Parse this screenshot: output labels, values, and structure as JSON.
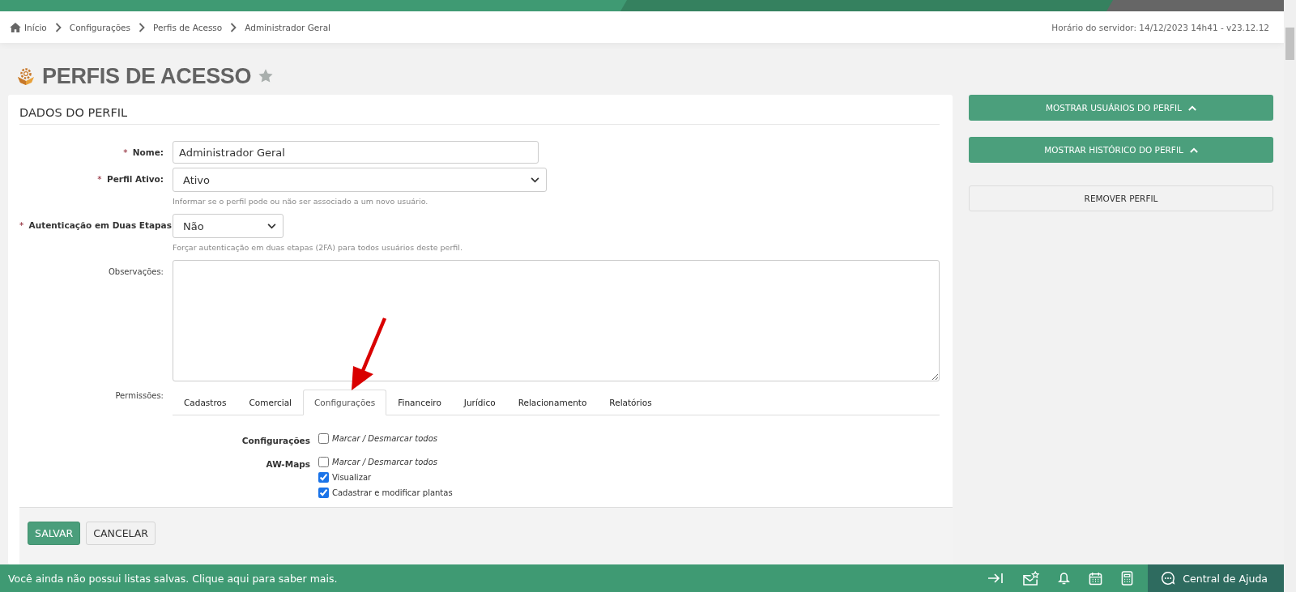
{
  "breadcrumb": {
    "items": [
      {
        "label": "Início"
      },
      {
        "label": "Configurações"
      },
      {
        "label": "Perfis de Acesso"
      },
      {
        "label": "Administrador Geral"
      }
    ],
    "server_time": "Horário do servidor: 14/12/2023 14h41 - v23.12.12"
  },
  "page": {
    "title": "PERFIS DE ACESSO",
    "favorite": false
  },
  "profile": {
    "heading": "DADOS DO PERFIL",
    "required_mark": "*",
    "fields": [
      {
        "kind": "text",
        "label": "Nome:",
        "required": true,
        "value": "Administrador Geral"
      },
      {
        "kind": "select",
        "label": "Perfil Ativo:",
        "required": true,
        "value": "Ativo",
        "hint": "Informar se o perfil pode ou não ser associado a um novo usuário."
      },
      {
        "kind": "short_select",
        "label": "Autenticação em Duas Etapas",
        "required": true,
        "value": "Não",
        "hint": "Forçar autenticação em duas etapas (2FA) para todos usuários deste perfil."
      },
      {
        "kind": "textarea",
        "label": "Observações:",
        "required": false
      }
    ]
  },
  "permissions": {
    "label": "Permissões:",
    "tabs": [
      {
        "label": "Cadastros",
        "selected": false
      },
      {
        "label": "Comercial",
        "selected": false
      },
      {
        "label": "Configurações",
        "selected": true
      },
      {
        "label": "Financeiro",
        "selected": false
      },
      {
        "label": "Jurídico",
        "selected": false
      },
      {
        "label": "Relacionamento",
        "selected": false
      },
      {
        "label": "Relatórios",
        "selected": false
      }
    ],
    "groups": [
      {
        "title": "Configurações",
        "toggle_label": "Marcar / Desmarcar todos",
        "toggle_checked": false
      },
      {
        "title": "AW-Maps",
        "toggle_label": "Marcar / Desmarcar todos",
        "toggle_checked": false,
        "items": [
          {
            "label": "Visualizar",
            "checked": true
          },
          {
            "label": "Cadastrar e modificar plantas",
            "checked": true
          }
        ]
      }
    ]
  },
  "actions": {
    "save": "SALVAR",
    "cancel": "CANCELAR"
  },
  "side_buttons": [
    {
      "kind": "primary",
      "label": "MOSTRAR USUÁRIOS DO PERFIL",
      "expanded": true
    },
    {
      "kind": "primary",
      "label": "MOSTRAR HISTÓRICO DO PERFIL",
      "expanded": true
    },
    {
      "kind": "plain",
      "label": "REMOVER PERFIL"
    }
  ],
  "footer": {
    "message": "Você ainda não possui listas salvas. Clique aqui para saber mais.",
    "help": "Central de Ajuda"
  }
}
